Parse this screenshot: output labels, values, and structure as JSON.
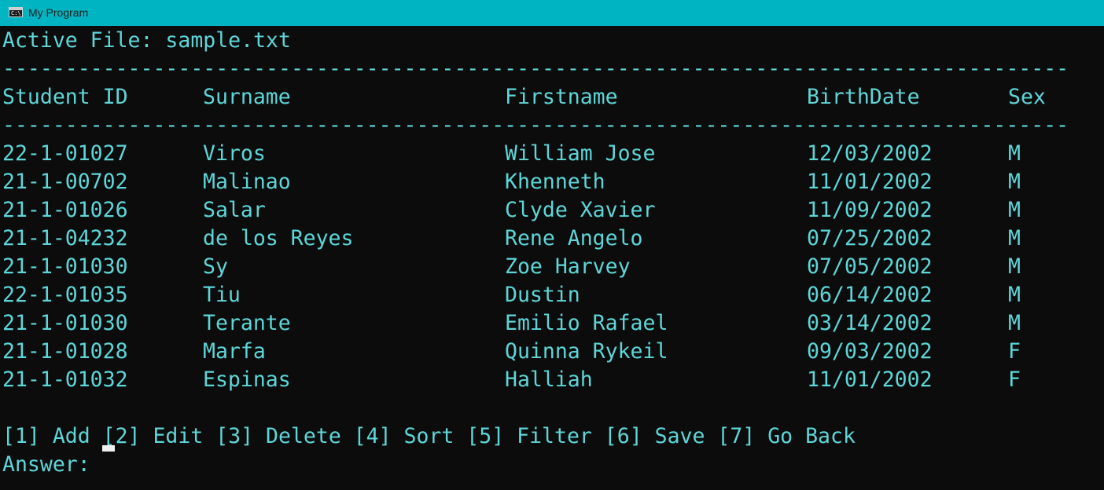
{
  "window": {
    "title": "My Program",
    "icon": "console-icon",
    "icon_glyph": "C:\\"
  },
  "terminal": {
    "active_file_line": "Active File: sample.txt",
    "separator": "----------------------------------------------------------------------------------------------------------------",
    "columns": [
      "Student ID",
      "Surname",
      "Firstname",
      "BirthDate",
      "Sex"
    ],
    "rows": [
      [
        "22-1-01027",
        "Viros",
        "William Jose",
        "12/03/2002",
        "M"
      ],
      [
        "21-1-00702",
        "Malinao",
        "Khenneth",
        "11/01/2002",
        "M"
      ],
      [
        "21-1-01026",
        "Salar",
        "Clyde Xavier",
        "11/09/2002",
        "M"
      ],
      [
        "21-1-04232",
        "de los Reyes",
        "Rene Angelo",
        "07/25/2002",
        "M"
      ],
      [
        "21-1-01030",
        "Sy",
        "Zoe Harvey",
        "07/05/2002",
        "M"
      ],
      [
        "22-1-01035",
        "Tiu",
        "Dustin",
        "06/14/2002",
        "M"
      ],
      [
        "21-1-01030",
        "Terante",
        "Emilio Rafael",
        "03/14/2002",
        "M"
      ],
      [
        "21-1-01028",
        "Marfa",
        "Quinna Rykeil",
        "09/03/2002",
        "F"
      ],
      [
        "21-1-01032",
        "Espinas",
        "Halliah",
        "11/01/2002",
        "F"
      ]
    ],
    "menu_line": "[1] Add [2] Edit [3] Delete [4] Sort [5] Filter [6] Save [7] Go Back",
    "prompt": "Answer: ",
    "input_value": ""
  },
  "colors": {
    "titlebar": "#00b4c2",
    "background": "#0c0c0c",
    "text": "#5ed6d8",
    "cursor": "#f0f0f0"
  }
}
